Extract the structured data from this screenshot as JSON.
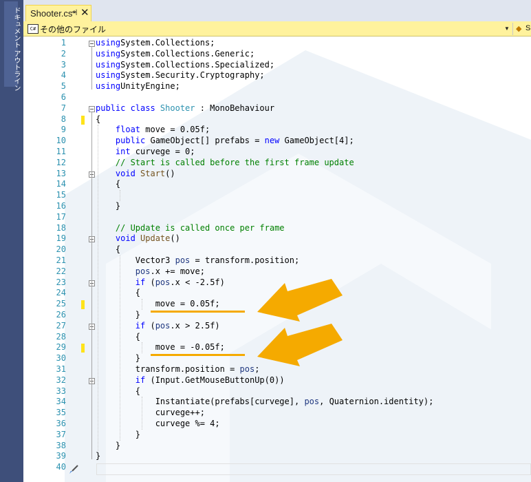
{
  "side_panel": {
    "label": "ドキュメント アウトライン"
  },
  "tab": {
    "title": "Shooter.cs*",
    "pin_icon": "pin-icon",
    "close_icon": "close-icon"
  },
  "nav": {
    "badge": "C#",
    "label": "その他のファイル",
    "dropdown_icon": "chevron-down-icon",
    "second_text": "S",
    "second_icon": "class-icon"
  },
  "code_lines": [
    {
      "n": "1",
      "tokens": [
        [
          "kw",
          "using"
        ],
        [
          "",
          "System.Collections;"
        ]
      ]
    },
    {
      "n": "2",
      "tokens": [
        [
          "kw",
          "using"
        ],
        [
          "",
          "System.Collections.Generic;"
        ]
      ]
    },
    {
      "n": "3",
      "tokens": [
        [
          "kw",
          "using"
        ],
        [
          "",
          "System.Collections.Specialized;"
        ]
      ]
    },
    {
      "n": "4",
      "tokens": [
        [
          "kw",
          "using"
        ],
        [
          "",
          "System.Security.Cryptography;"
        ]
      ]
    },
    {
      "n": "5",
      "tokens": [
        [
          "kw",
          "using"
        ],
        [
          "",
          "UnityEngine;"
        ]
      ]
    },
    {
      "n": "6",
      "tokens": []
    },
    {
      "n": "7",
      "tokens": [
        [
          "kw",
          "public class"
        ],
        [
          "ty",
          "Shooter"
        ],
        [
          "",
          " : MonoBehaviour"
        ]
      ]
    },
    {
      "n": "8",
      "tokens": [
        [
          "",
          "{"
        ]
      ]
    },
    {
      "n": "9",
      "tokens": [
        [
          "kw",
          "    float"
        ],
        [
          "",
          " move = 0.05f;"
        ]
      ]
    },
    {
      "n": "10",
      "tokens": [
        [
          "kw",
          "    public"
        ],
        [
          "",
          " GameObject[] prefabs = "
        ],
        [
          "kw",
          "new"
        ],
        [
          "",
          " GameObject[4];"
        ]
      ]
    },
    {
      "n": "11",
      "tokens": [
        [
          "kw",
          "    int"
        ],
        [
          "",
          " curvege = 0;"
        ]
      ]
    },
    {
      "n": "12",
      "tokens": [
        [
          "cm",
          "    // Start is called before the first frame update"
        ]
      ]
    },
    {
      "n": "13",
      "tokens": [
        [
          "kw",
          "    void"
        ],
        [
          "fn",
          "Start"
        ],
        [
          "",
          "()"
        ]
      ]
    },
    {
      "n": "14",
      "tokens": [
        [
          "",
          "    {"
        ]
      ]
    },
    {
      "n": "15",
      "tokens": []
    },
    {
      "n": "16",
      "tokens": [
        [
          "",
          "    }"
        ]
      ]
    },
    {
      "n": "17",
      "tokens": []
    },
    {
      "n": "18",
      "tokens": [
        [
          "cm",
          "    // Update is called once per frame"
        ]
      ]
    },
    {
      "n": "19",
      "tokens": [
        [
          "kw",
          "    void"
        ],
        [
          "fn",
          "Update"
        ],
        [
          "",
          "()"
        ]
      ]
    },
    {
      "n": "20",
      "tokens": [
        [
          "",
          "    {"
        ]
      ]
    },
    {
      "n": "21",
      "tokens": [
        [
          "",
          "        Vector3 "
        ],
        [
          "pa",
          "pos"
        ],
        [
          "",
          " = transform.position;"
        ]
      ]
    },
    {
      "n": "22",
      "tokens": [
        [
          "pa",
          "        pos"
        ],
        [
          "",
          ".x += move;"
        ]
      ]
    },
    {
      "n": "23",
      "tokens": [
        [
          "kw",
          "        if"
        ],
        [
          "",
          " ("
        ],
        [
          "pa",
          "pos"
        ],
        [
          "",
          ".x < -2.5f)"
        ]
      ]
    },
    {
      "n": "24",
      "tokens": [
        [
          "",
          "        {"
        ]
      ]
    },
    {
      "n": "25",
      "tokens": [
        [
          "",
          "            move = 0.05f;"
        ]
      ]
    },
    {
      "n": "26",
      "tokens": [
        [
          "",
          "        }"
        ]
      ]
    },
    {
      "n": "27",
      "tokens": [
        [
          "kw",
          "        if"
        ],
        [
          "",
          " ("
        ],
        [
          "pa",
          "pos"
        ],
        [
          "",
          ".x > 2.5f)"
        ]
      ]
    },
    {
      "n": "28",
      "tokens": [
        [
          "",
          "        {"
        ]
      ]
    },
    {
      "n": "29",
      "tokens": [
        [
          "",
          "            move = -0.05f;"
        ]
      ]
    },
    {
      "n": "30",
      "tokens": [
        [
          "",
          "        }"
        ]
      ]
    },
    {
      "n": "31",
      "tokens": [
        [
          "",
          "        transform.position = "
        ],
        [
          "pa",
          "pos"
        ],
        [
          "",
          ";"
        ]
      ]
    },
    {
      "n": "32",
      "tokens": [
        [
          "kw",
          "        if"
        ],
        [
          "",
          " (Input.GetMouseButtonUp(0))"
        ]
      ]
    },
    {
      "n": "33",
      "tokens": [
        [
          "",
          "        {"
        ]
      ]
    },
    {
      "n": "34",
      "tokens": [
        [
          "",
          "            Instantiate(prefabs[curvege], "
        ],
        [
          "pa",
          "pos"
        ],
        [
          "",
          ", Quaternion.identity);"
        ]
      ]
    },
    {
      "n": "35",
      "tokens": [
        [
          "",
          "            curvege++;"
        ]
      ]
    },
    {
      "n": "36",
      "tokens": [
        [
          "",
          "            curvege %= 4;"
        ]
      ]
    },
    {
      "n": "37",
      "tokens": [
        [
          "",
          "        }"
        ]
      ]
    },
    {
      "n": "38",
      "tokens": [
        [
          "",
          "    }"
        ]
      ]
    },
    {
      "n": "39",
      "tokens": [
        [
          "",
          "}"
        ]
      ]
    },
    {
      "n": "40",
      "tokens": []
    }
  ],
  "changed_lines": [
    "8",
    "25",
    "29"
  ],
  "fold_lines": [
    "1",
    "7",
    "13",
    "19",
    "23",
    "27",
    "32"
  ],
  "accent_color": "#f5aa00",
  "change_marker_color": "#ffe31a"
}
